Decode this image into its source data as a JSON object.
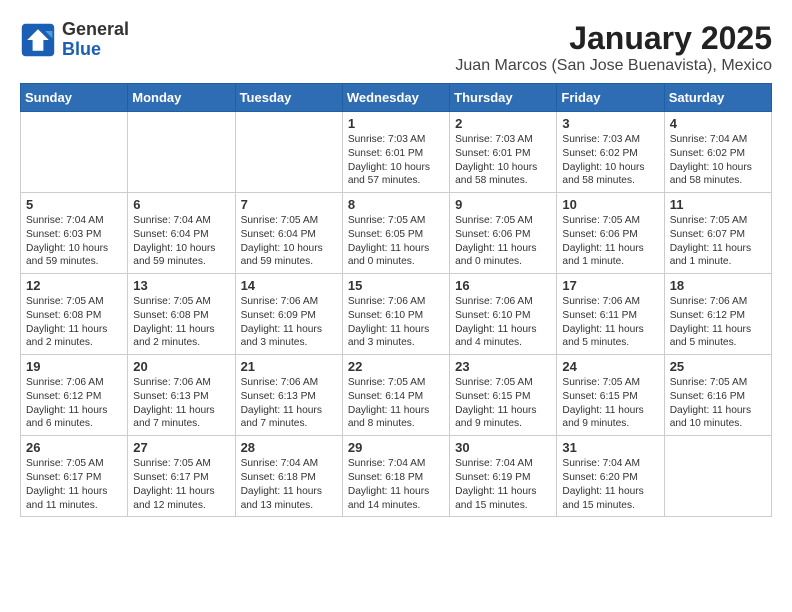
{
  "header": {
    "logo_line1": "General",
    "logo_line2": "Blue",
    "main_title": "January 2025",
    "sub_title": "Juan Marcos (San Jose Buenavista), Mexico"
  },
  "weekdays": [
    "Sunday",
    "Monday",
    "Tuesday",
    "Wednesday",
    "Thursday",
    "Friday",
    "Saturday"
  ],
  "weeks": [
    [
      {
        "day": "",
        "info": ""
      },
      {
        "day": "",
        "info": ""
      },
      {
        "day": "",
        "info": ""
      },
      {
        "day": "1",
        "info": "Sunrise: 7:03 AM\nSunset: 6:01 PM\nDaylight: 10 hours\nand 57 minutes."
      },
      {
        "day": "2",
        "info": "Sunrise: 7:03 AM\nSunset: 6:01 PM\nDaylight: 10 hours\nand 58 minutes."
      },
      {
        "day": "3",
        "info": "Sunrise: 7:03 AM\nSunset: 6:02 PM\nDaylight: 10 hours\nand 58 minutes."
      },
      {
        "day": "4",
        "info": "Sunrise: 7:04 AM\nSunset: 6:02 PM\nDaylight: 10 hours\nand 58 minutes."
      }
    ],
    [
      {
        "day": "5",
        "info": "Sunrise: 7:04 AM\nSunset: 6:03 PM\nDaylight: 10 hours\nand 59 minutes."
      },
      {
        "day": "6",
        "info": "Sunrise: 7:04 AM\nSunset: 6:04 PM\nDaylight: 10 hours\nand 59 minutes."
      },
      {
        "day": "7",
        "info": "Sunrise: 7:05 AM\nSunset: 6:04 PM\nDaylight: 10 hours\nand 59 minutes."
      },
      {
        "day": "8",
        "info": "Sunrise: 7:05 AM\nSunset: 6:05 PM\nDaylight: 11 hours\nand 0 minutes."
      },
      {
        "day": "9",
        "info": "Sunrise: 7:05 AM\nSunset: 6:06 PM\nDaylight: 11 hours\nand 0 minutes."
      },
      {
        "day": "10",
        "info": "Sunrise: 7:05 AM\nSunset: 6:06 PM\nDaylight: 11 hours\nand 1 minute."
      },
      {
        "day": "11",
        "info": "Sunrise: 7:05 AM\nSunset: 6:07 PM\nDaylight: 11 hours\nand 1 minute."
      }
    ],
    [
      {
        "day": "12",
        "info": "Sunrise: 7:05 AM\nSunset: 6:08 PM\nDaylight: 11 hours\nand 2 minutes."
      },
      {
        "day": "13",
        "info": "Sunrise: 7:05 AM\nSunset: 6:08 PM\nDaylight: 11 hours\nand 2 minutes."
      },
      {
        "day": "14",
        "info": "Sunrise: 7:06 AM\nSunset: 6:09 PM\nDaylight: 11 hours\nand 3 minutes."
      },
      {
        "day": "15",
        "info": "Sunrise: 7:06 AM\nSunset: 6:10 PM\nDaylight: 11 hours\nand 3 minutes."
      },
      {
        "day": "16",
        "info": "Sunrise: 7:06 AM\nSunset: 6:10 PM\nDaylight: 11 hours\nand 4 minutes."
      },
      {
        "day": "17",
        "info": "Sunrise: 7:06 AM\nSunset: 6:11 PM\nDaylight: 11 hours\nand 5 minutes."
      },
      {
        "day": "18",
        "info": "Sunrise: 7:06 AM\nSunset: 6:12 PM\nDaylight: 11 hours\nand 5 minutes."
      }
    ],
    [
      {
        "day": "19",
        "info": "Sunrise: 7:06 AM\nSunset: 6:12 PM\nDaylight: 11 hours\nand 6 minutes."
      },
      {
        "day": "20",
        "info": "Sunrise: 7:06 AM\nSunset: 6:13 PM\nDaylight: 11 hours\nand 7 minutes."
      },
      {
        "day": "21",
        "info": "Sunrise: 7:06 AM\nSunset: 6:13 PM\nDaylight: 11 hours\nand 7 minutes."
      },
      {
        "day": "22",
        "info": "Sunrise: 7:05 AM\nSunset: 6:14 PM\nDaylight: 11 hours\nand 8 minutes."
      },
      {
        "day": "23",
        "info": "Sunrise: 7:05 AM\nSunset: 6:15 PM\nDaylight: 11 hours\nand 9 minutes."
      },
      {
        "day": "24",
        "info": "Sunrise: 7:05 AM\nSunset: 6:15 PM\nDaylight: 11 hours\nand 9 minutes."
      },
      {
        "day": "25",
        "info": "Sunrise: 7:05 AM\nSunset: 6:16 PM\nDaylight: 11 hours\nand 10 minutes."
      }
    ],
    [
      {
        "day": "26",
        "info": "Sunrise: 7:05 AM\nSunset: 6:17 PM\nDaylight: 11 hours\nand 11 minutes."
      },
      {
        "day": "27",
        "info": "Sunrise: 7:05 AM\nSunset: 6:17 PM\nDaylight: 11 hours\nand 12 minutes."
      },
      {
        "day": "28",
        "info": "Sunrise: 7:04 AM\nSunset: 6:18 PM\nDaylight: 11 hours\nand 13 minutes."
      },
      {
        "day": "29",
        "info": "Sunrise: 7:04 AM\nSunset: 6:18 PM\nDaylight: 11 hours\nand 14 minutes."
      },
      {
        "day": "30",
        "info": "Sunrise: 7:04 AM\nSunset: 6:19 PM\nDaylight: 11 hours\nand 15 minutes."
      },
      {
        "day": "31",
        "info": "Sunrise: 7:04 AM\nSunset: 6:20 PM\nDaylight: 11 hours\nand 15 minutes."
      },
      {
        "day": "",
        "info": ""
      }
    ]
  ]
}
